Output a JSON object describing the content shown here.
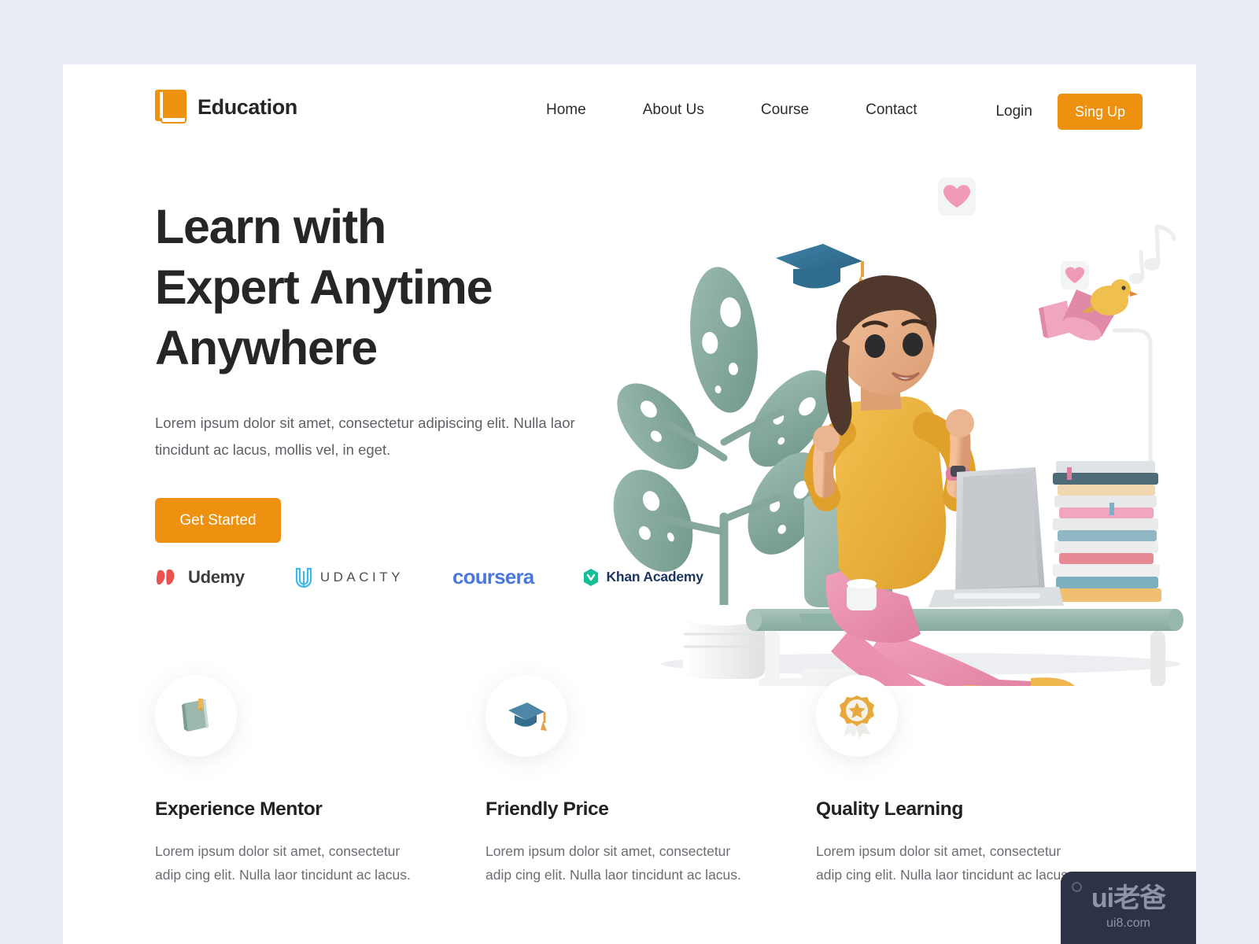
{
  "brand": {
    "name": "Education",
    "icon": "book-icon",
    "accent_color": "#EF9110"
  },
  "nav": {
    "items": [
      {
        "label": "Home"
      },
      {
        "label": "About Us"
      },
      {
        "label": "Course"
      },
      {
        "label": "Contact"
      }
    ],
    "login_label": "Login",
    "signup_label": "Sing Up"
  },
  "hero": {
    "title_line1": "Learn with",
    "title_line2": "Expert Anytime",
    "title_line3": "Anywhere",
    "subtitle": "Lorem ipsum dolor sit amet, consectetur adipiscing elit. Nulla laor tincidunt ac lacus, mollis vel, in eget.",
    "cta_label": "Get Started"
  },
  "partners": [
    {
      "name": "Udemy",
      "mark": "udemy-u-mark",
      "mark_color": "#EA5252",
      "text_color": "#3D3D3D"
    },
    {
      "name": "UDACITY",
      "mark": "udacity-u-mark",
      "mark_color": "#3CB9E8",
      "text_color": "#4A4F55"
    },
    {
      "name": "coursera",
      "mark": "none",
      "mark_color": "#4A77DF",
      "text_color": "#4A77DF"
    },
    {
      "name": "Khan Academy",
      "mark": "khan-hexagon-mark",
      "mark_color": "#14BF96",
      "text_color": "#1C355E"
    }
  ],
  "features": [
    {
      "icon": "book-3d-icon",
      "title": "Experience Mentor",
      "description": "Lorem ipsum dolor sit amet, consectetur adip cing elit. Nulla laor tincidunt ac lacus."
    },
    {
      "icon": "graduation-cap-3d-icon",
      "title": "Friendly Price",
      "description": "Lorem ipsum dolor sit amet, consectetur adip cing elit. Nulla laor tincidunt ac lacus."
    },
    {
      "icon": "award-ribbon-3d-icon",
      "title": "Quality Learning",
      "description": "Lorem ipsum dolor sit amet, consectetur adip cing elit. Nulla laor tincidunt ac lacus."
    }
  ],
  "illustration": {
    "name": "student-at-desk-3d-illustration",
    "elements": [
      "potted-plant",
      "graduation-cap",
      "heart-sticker",
      "music-note",
      "desk-lamp",
      "bird-figurine",
      "book-stack",
      "laptop",
      "chair",
      "woman-studying",
      "pink-notebook"
    ]
  },
  "watermark": {
    "main": "ui老爸",
    "sub": "ui8.com"
  },
  "theme": {
    "page_bg": "#E9ECF4",
    "card_bg": "#FFFFFF",
    "accent": "#EF9110",
    "heading_color": "#262626",
    "body_color": "#5E6166"
  }
}
